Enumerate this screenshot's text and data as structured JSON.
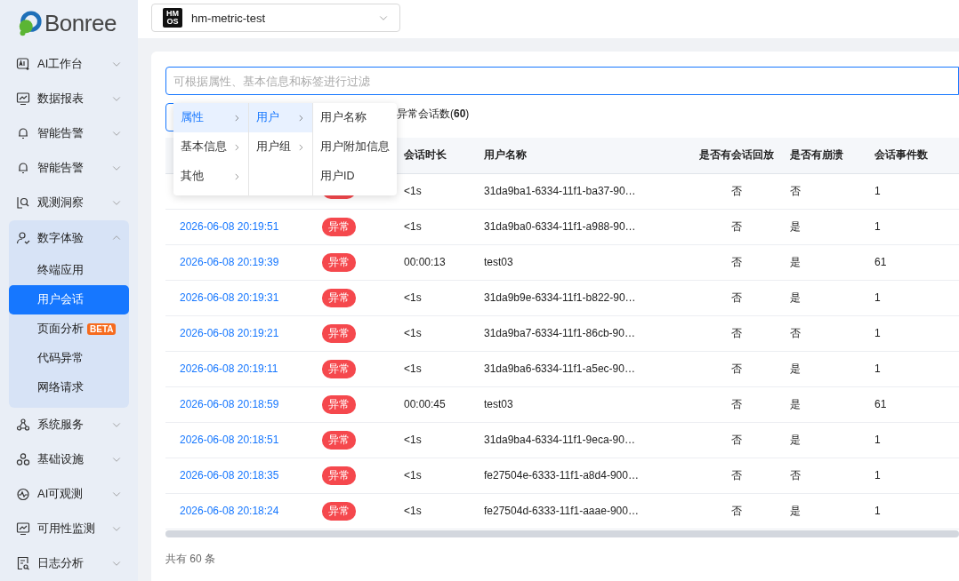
{
  "logo": {
    "text": "Bonree"
  },
  "sidebar": {
    "items": [
      {
        "label": "AI工作台",
        "expanded": false
      },
      {
        "label": "数据报表",
        "expanded": false
      },
      {
        "label": "智能告警",
        "expanded": false
      },
      {
        "label": "智能告警",
        "expanded": false
      },
      {
        "label": "观测洞察",
        "expanded": false
      },
      {
        "label": "数字体验",
        "expanded": true,
        "children": [
          {
            "label": "终端应用",
            "selected": false
          },
          {
            "label": "用户会话",
            "selected": true
          },
          {
            "label": "页面分析",
            "selected": false,
            "badge": "BETA"
          },
          {
            "label": "代码异常",
            "selected": false
          },
          {
            "label": "网络请求",
            "selected": false
          }
        ]
      },
      {
        "label": "系统服务",
        "expanded": false
      },
      {
        "label": "基础设施",
        "expanded": false
      },
      {
        "label": "AI可观测",
        "expanded": false
      },
      {
        "label": "可用性监测",
        "expanded": false
      },
      {
        "label": "日志分析",
        "expanded": false
      }
    ]
  },
  "app_selector": {
    "badge": "HMOS",
    "value": "hm-metric-test"
  },
  "filter": {
    "placeholder": "可根据属性、基本信息和标签进行过滤"
  },
  "abnormal_count": "异常会话数(**60**)",
  "cascader": {
    "columns": [
      [
        {
          "label": "属性",
          "selected": true
        },
        {
          "label": "基本信息",
          "selected": false
        },
        {
          "label": "其他",
          "selected": false
        }
      ],
      [
        {
          "label": "用户",
          "selected": true
        },
        {
          "label": "用户组",
          "selected": false
        }
      ],
      [
        {
          "label": "用户名称",
          "selected": false
        },
        {
          "label": "用户附加信息",
          "selected": false
        },
        {
          "label": "用户ID",
          "selected": false
        }
      ]
    ]
  },
  "table": {
    "columns": [
      "会话时长",
      "用户名称",
      "是否有会话回放",
      "是否有崩溃",
      "会话事件数"
    ],
    "rows": [
      {
        "time": null,
        "abnormal": true,
        "duration": "<1s",
        "user": "31da9ba1-6334-11f1-ba37-90…",
        "replay": "否",
        "crash": "否",
        "events": "1"
      },
      {
        "time": "2026-06-08 20:19:51",
        "abnormal": true,
        "status": "异常",
        "duration": "<1s",
        "user": "31da9ba0-6334-11f1-a988-90…",
        "replay": "否",
        "crash": "是",
        "events": "1"
      },
      {
        "time": "2026-06-08 20:19:39",
        "abnormal": true,
        "status": "异常",
        "duration": "00:00:13",
        "user": "test03",
        "replay": "否",
        "crash": "是",
        "events": "61"
      },
      {
        "time": "2026-06-08 20:19:31",
        "abnormal": true,
        "status": "异常",
        "duration": "<1s",
        "user": "31da9b9e-6334-11f1-b822-90…",
        "replay": "否",
        "crash": "是",
        "events": "1"
      },
      {
        "time": "2026-06-08 20:19:21",
        "abnormal": true,
        "status": "异常",
        "duration": "<1s",
        "user": "31da9ba7-6334-11f1-86cb-90…",
        "replay": "否",
        "crash": "否",
        "events": "1"
      },
      {
        "time": "2026-06-08 20:19:11",
        "abnormal": true,
        "status": "异常",
        "duration": "<1s",
        "user": "31da9ba6-6334-11f1-a5ec-90…",
        "replay": "否",
        "crash": "是",
        "events": "1"
      },
      {
        "time": "2026-06-08 20:18:59",
        "abnormal": true,
        "status": "异常",
        "duration": "00:00:45",
        "user": "test03",
        "replay": "否",
        "crash": "是",
        "events": "61"
      },
      {
        "time": "2026-06-08 20:18:51",
        "abnormal": true,
        "status": "异常",
        "duration": "<1s",
        "user": "31da9ba4-6334-11f1-9eca-90…",
        "replay": "否",
        "crash": "是",
        "events": "1"
      },
      {
        "time": "2026-06-08 20:18:35",
        "abnormal": true,
        "status": "异常",
        "duration": "<1s",
        "user": "fe27504e-6333-11f1-a8d4-900…",
        "replay": "否",
        "crash": "否",
        "events": "1"
      },
      {
        "time": "2026-06-08 20:18:24",
        "abnormal": true,
        "status": "异常",
        "duration": "<1s",
        "user": "fe27504d-6333-11f1-aaae-900…",
        "replay": "否",
        "crash": "是",
        "events": "1"
      }
    ]
  },
  "footer": "共有 60 条"
}
